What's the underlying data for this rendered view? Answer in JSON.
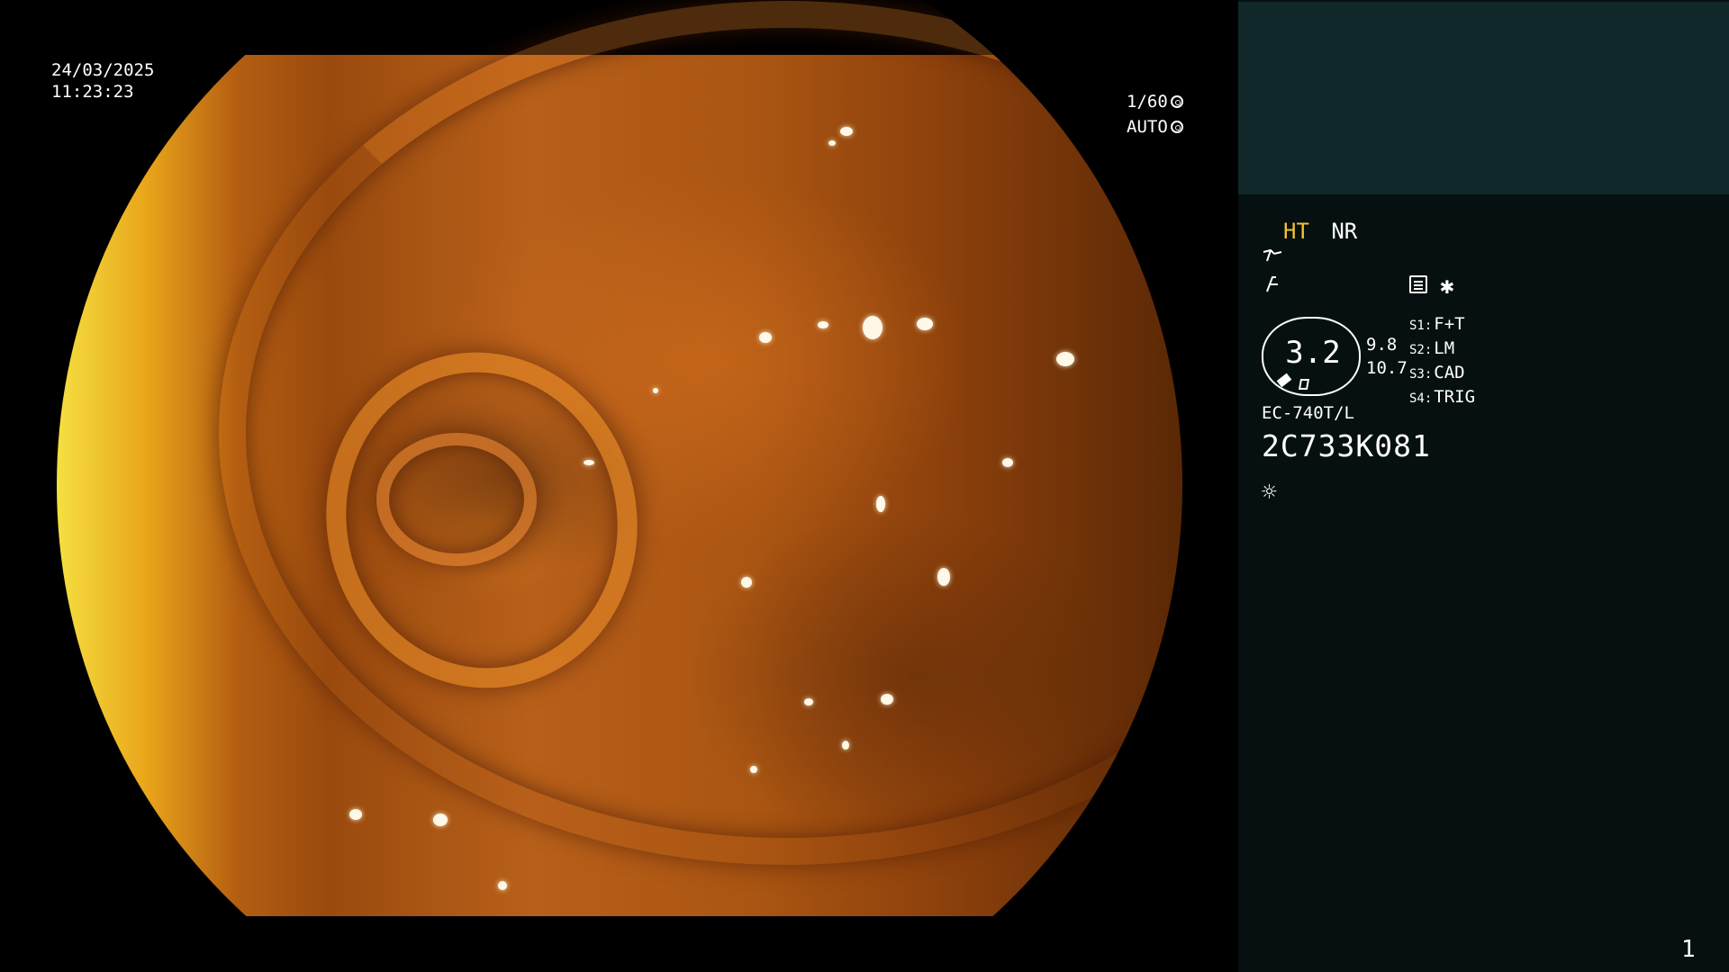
{
  "overlay": {
    "date": "24/03/2025",
    "time": "11:23:23",
    "shutter": "1/60",
    "iris": "AUTO"
  },
  "panel": {
    "mode_ht": "HT",
    "mode_nr": "NR",
    "zoom": "3.2",
    "value_top": "9.8",
    "value_bottom": "10.7",
    "switches": [
      {
        "key": "S1:",
        "label": "F+T"
      },
      {
        "key": "S2:",
        "label": "LM"
      },
      {
        "key": "S3:",
        "label": "CAD"
      },
      {
        "key": "S4:",
        "label": "TRIG"
      }
    ],
    "scope_model": "EC-740T/L",
    "scope_serial": "2C733K081",
    "page_number": "1"
  },
  "colors": {
    "ht_accent": "#f2c12e",
    "panel_bg": "#061010",
    "thumb_bg": "#10282a"
  },
  "icons": [
    "shutter-icon",
    "iris-icon",
    "wave-icon",
    "enhance-icon",
    "menu-icon",
    "star-icon",
    "zoom-tip-icon",
    "light-icon"
  ]
}
